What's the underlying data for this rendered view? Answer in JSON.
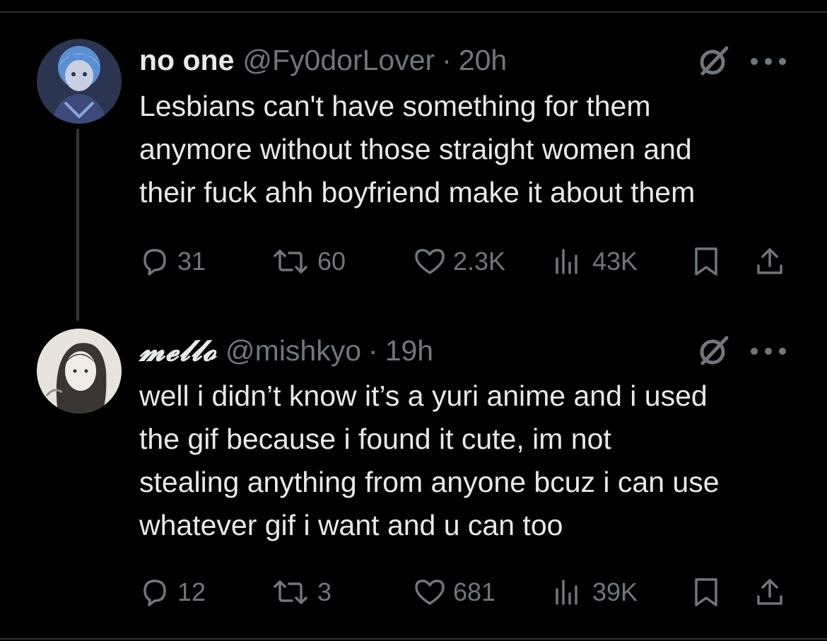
{
  "tweets": [
    {
      "display_name": "no one",
      "handle": "@Fy0dorLover",
      "separator": "·",
      "time": "20h",
      "text": "Lesbians can't have something for them\nanymore without those straight women and\ntheir fuck ahh boyfriend make it about them",
      "replies": "31",
      "reposts": "60",
      "likes": "2.3K",
      "views": "43K"
    },
    {
      "display_name": "𝓶𝓮𝓵𝓵𝓸",
      "handle": "@mishkyo",
      "separator": "·",
      "time": "19h",
      "text": "well i didn’t know it’s a yuri anime and i used\nthe gif because i found it cute, im not\nstealing anything from anyone bcuz i can use\nwhatever gif i want and u can too",
      "replies": "12",
      "reposts": "3",
      "likes": "681",
      "views": "39K"
    }
  ],
  "icons": {
    "reply": "reply-icon",
    "repost": "repost-icon",
    "like": "heart-icon",
    "views": "views-icon",
    "bookmark": "bookmark-icon",
    "share": "share-icon",
    "grok": "grok-icon",
    "more": "more-icon"
  },
  "colors": {
    "background": "#000000",
    "text": "#e7e9ea",
    "muted": "#71767b",
    "divider": "#2f3336"
  }
}
